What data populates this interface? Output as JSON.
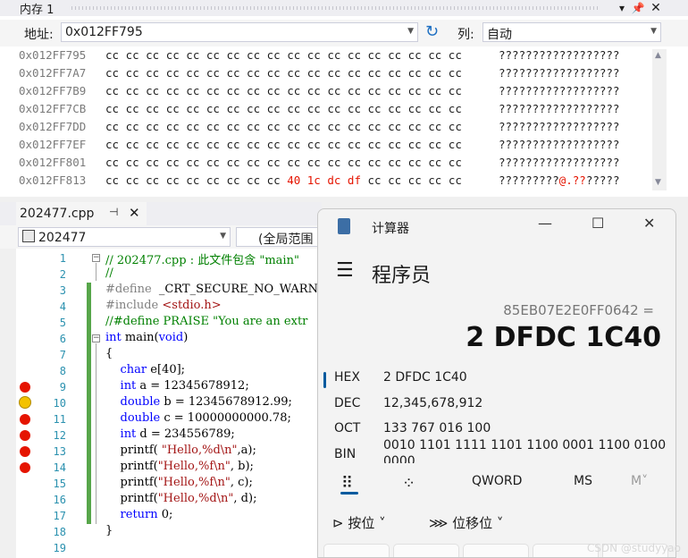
{
  "memory": {
    "title": "内存 1",
    "address_label": "地址:",
    "address_value": "0x012FF795",
    "columns_label": "列:",
    "columns_value": "自动",
    "rows": [
      {
        "addr": "0x012FF795",
        "bytes_pre": "cc cc cc cc cc cc cc cc cc cc cc cc cc cc cc cc cc cc",
        "bytes_red": "",
        "bytes_post": "",
        "chars": "??????????????????"
      },
      {
        "addr": "0x012FF7A7",
        "bytes_pre": "cc cc cc cc cc cc cc cc cc cc cc cc cc cc cc cc cc cc",
        "bytes_red": "",
        "bytes_post": "",
        "chars": "??????????????????"
      },
      {
        "addr": "0x012FF7B9",
        "bytes_pre": "cc cc cc cc cc cc cc cc cc cc cc cc cc cc cc cc cc cc",
        "bytes_red": "",
        "bytes_post": "",
        "chars": "??????????????????"
      },
      {
        "addr": "0x012FF7CB",
        "bytes_pre": "cc cc cc cc cc cc cc cc cc cc cc cc cc cc cc cc cc cc",
        "bytes_red": "",
        "bytes_post": "",
        "chars": "??????????????????"
      },
      {
        "addr": "0x012FF7DD",
        "bytes_pre": "cc cc cc cc cc cc cc cc cc cc cc cc cc cc cc cc cc cc",
        "bytes_red": "",
        "bytes_post": "",
        "chars": "??????????????????"
      },
      {
        "addr": "0x012FF7EF",
        "bytes_pre": "cc cc cc cc cc cc cc cc cc cc cc cc cc cc cc cc cc cc",
        "bytes_red": "",
        "bytes_post": "",
        "chars": "??????????????????"
      },
      {
        "addr": "0x012FF801",
        "bytes_pre": "cc cc cc cc cc cc cc cc cc cc cc cc cc cc cc cc cc cc",
        "bytes_red": "",
        "bytes_post": "",
        "chars": "??????????????????"
      },
      {
        "addr": "0x012FF813",
        "bytes_pre": "cc cc cc cc cc cc cc cc cc ",
        "bytes_red": "40 1c dc df",
        "bytes_post": " cc cc cc cc cc",
        "chars_pre": "?????????",
        "chars_red": "@.??",
        "chars_post": "?????"
      }
    ]
  },
  "editor": {
    "tab_name": "202477.cpp",
    "nav_left": "202477",
    "nav_right": "(全局范围",
    "line_numbers": [
      "1",
      "2",
      "3",
      "4",
      "5",
      "6",
      "7",
      "8",
      "9",
      "10",
      "11",
      "12",
      "13",
      "14",
      "15",
      "16",
      "17",
      "18",
      "19"
    ]
  },
  "calculator": {
    "title": "计算器",
    "mode": "程序员",
    "expression": "85EB07E2E0FF0642 =",
    "result": "2 DFDC 1C40",
    "hex_label": "HEX",
    "hex_value": "2 DFDC 1C40",
    "dec_label": "DEC",
    "dec_value": "12,345,678,912",
    "oct_label": "OCT",
    "oct_value": "133 767 016 100",
    "bin_label": "BIN",
    "bin_value": "0010 1101 1111 1101 1100 0001 1100 0100",
    "bin_value_2": "0000",
    "word_size": "QWORD",
    "ms": "MS",
    "mv": "M",
    "bitwise": "按位",
    "bitshift": "位移位"
  },
  "watermark": "CSDN @studyyao"
}
